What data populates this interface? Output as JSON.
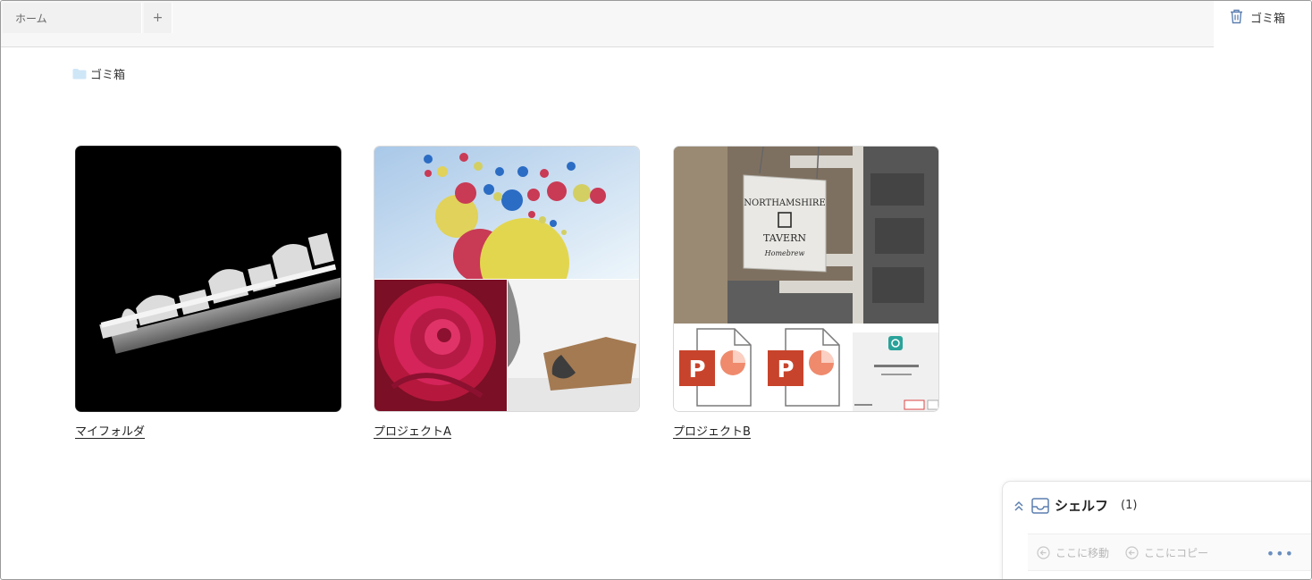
{
  "tabs": {
    "home_label": "ホーム",
    "add_label": "+",
    "trash_label": "ゴミ箱"
  },
  "breadcrumb": {
    "label": "ゴミ箱"
  },
  "folders": [
    {
      "name": "マイフォルダ"
    },
    {
      "name": "プロジェクトA"
    },
    {
      "name": "プロジェクトB"
    }
  ],
  "thumb_texts": {
    "tavern_line1": "NORTHAMSHIRE",
    "tavern_line2": "TAVERN",
    "tavern_line3": "Homebrew",
    "ppt_letter": "P"
  },
  "shelf": {
    "title": "シェルフ",
    "count": "(1)",
    "move_label": "ここに移動",
    "copy_label": "ここにコピー",
    "more_label": "•••"
  },
  "colors": {
    "accent": "#4a7bbf",
    "ppt_red": "#c8432b",
    "folder_blue": "#cfe6f7"
  }
}
